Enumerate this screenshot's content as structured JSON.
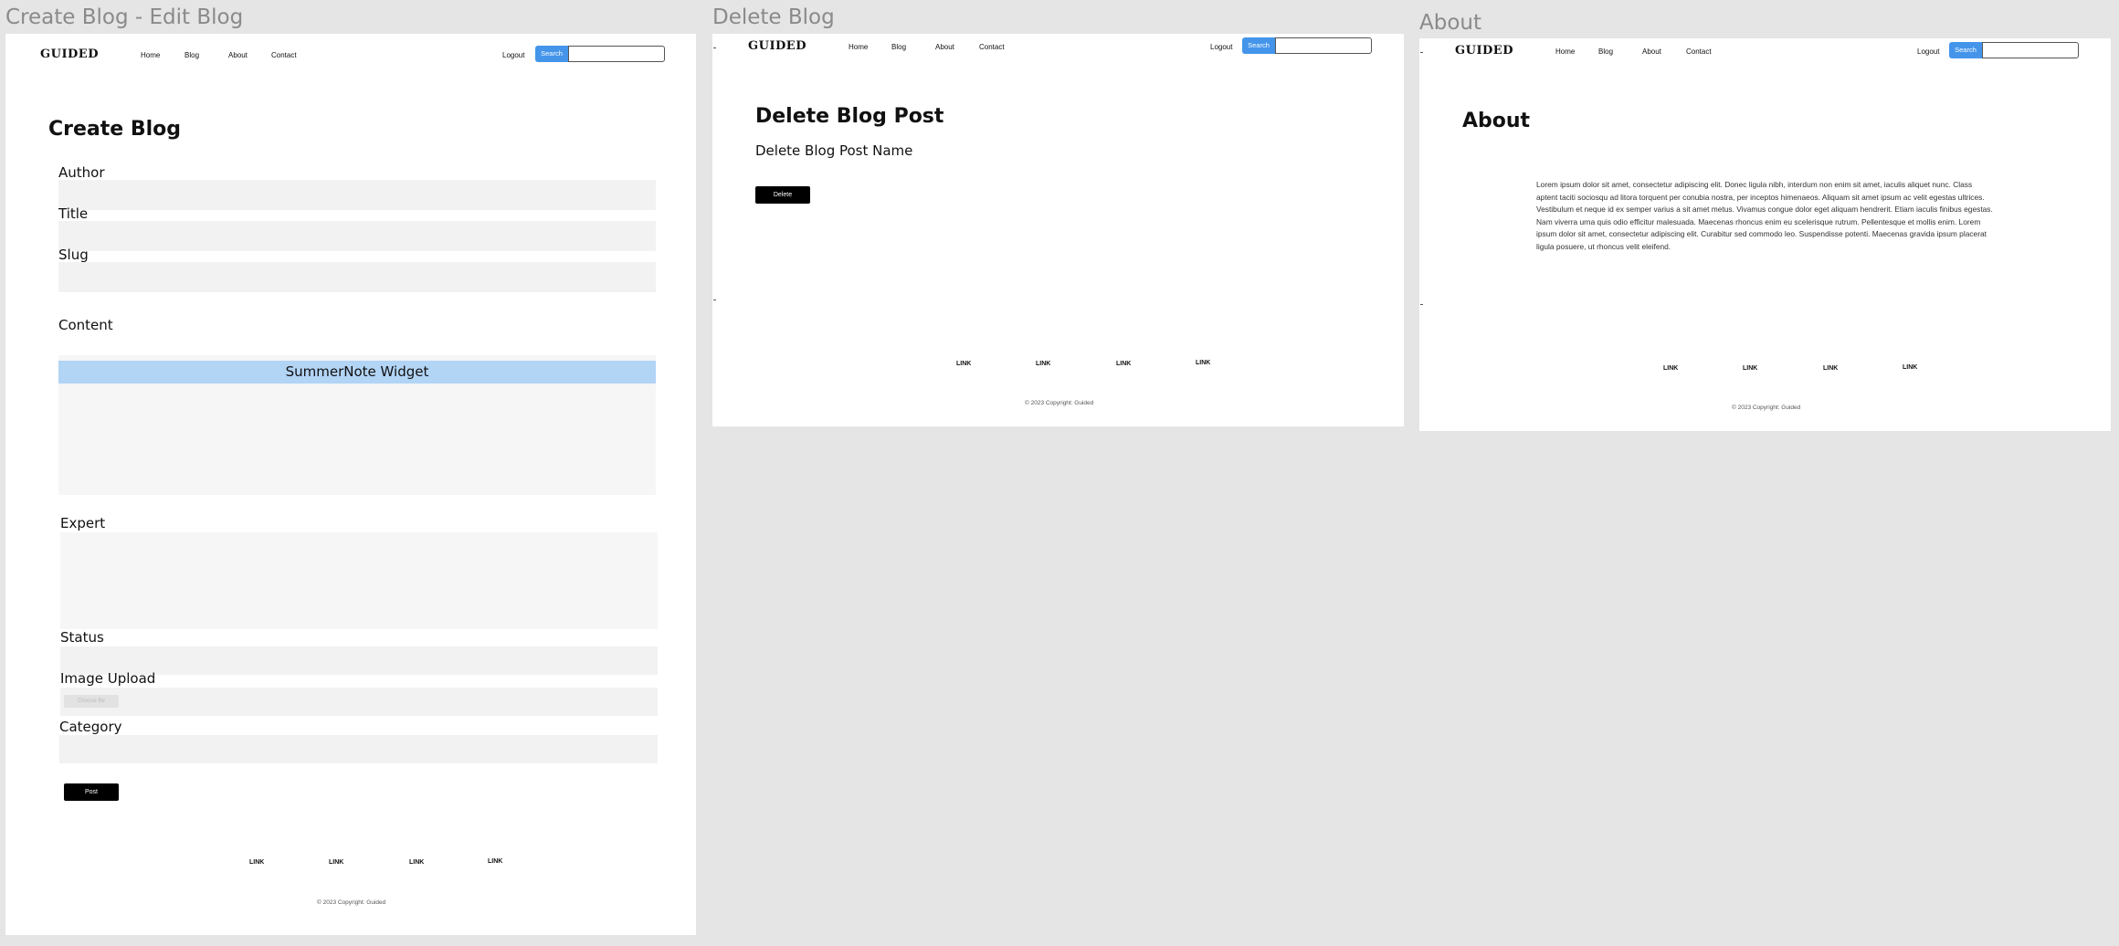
{
  "frames": {
    "create": {
      "title": "Create Blog - Edit Blog"
    },
    "delete": {
      "title": "Delete Blog"
    },
    "about": {
      "title": "About"
    }
  },
  "nav": {
    "logo": "GUIDED",
    "links": [
      "Home",
      "Blog",
      "About",
      "Contact"
    ],
    "logout": "Logout",
    "search_button": "Search",
    "search_placeholder": ""
  },
  "create_page": {
    "heading": "Create Blog",
    "fields": {
      "author": "Author",
      "title": "Title",
      "slug": "Slug",
      "content": "Content",
      "expert": "Expert",
      "status": "Status",
      "image_upload": "Image Upload",
      "category": "Category"
    },
    "widget": "SummerNote Widget",
    "choose_file": "Choose file",
    "post_button": "Post"
  },
  "delete_page": {
    "heading": "Delete Blog Post",
    "post_name": "Delete Blog Post Name",
    "delete_button": "Delete"
  },
  "about_page": {
    "heading": "About",
    "body": "Lorem ipsum dolor sit amet, consectetur adipiscing elit. Donec ligula nibh, interdum non enim sit amet, iaculis aliquet nunc. Class aptent taciti sociosqu ad litora torquent per conubia nostra, per inceptos himenaeos. Aliquam sit amet ipsum ac velit egestas ultrices. Vestibulum et neque id ex semper varius a sit amet metus. Vivamus congue dolor eget aliquam hendrerit. Etiam iaculis finibus egestas. Nam viverra urna quis odio efficitur malesuada. Maecenas rhoncus enim eu scelerisque rutrum. Pellentesque et mollis enim. Lorem ipsum dolor sit amet, consectetur adipiscing elit. Curabitur sed commodo leo. Suspendisse potenti. Maecenas gravida ipsum placerat ligula posuere, ut rhoncus velit eleifend."
  },
  "footer": {
    "links": [
      "LINK",
      "LINK",
      "LINK",
      "LINK"
    ],
    "copyright": "© 2023 Copyright: Guided"
  },
  "colors": {
    "search_button": "#4495ea",
    "widget_bar": "#b2d4f5",
    "field_bg": "#f2f2f2",
    "canvas_bg": "#e5e5e5"
  }
}
